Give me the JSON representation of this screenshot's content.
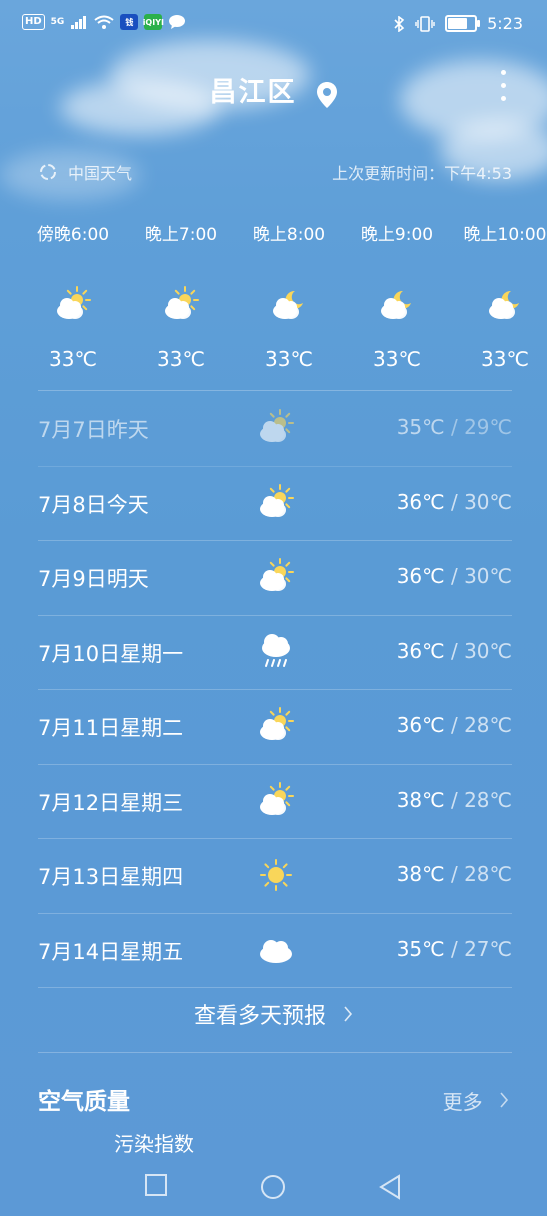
{
  "status": {
    "network": "HD",
    "signal_type": "5G",
    "app1": "钱",
    "app2": "iQIYI",
    "time": "5:23",
    "battery_percent": 88
  },
  "header": {
    "city": "昌江区",
    "icons": [
      "location-pin-icon",
      "more-vert-icon"
    ]
  },
  "source": {
    "provider": "中国天气",
    "updated": "上次更新时间：下午4:53"
  },
  "hourly": [
    {
      "time": "傍晚6:00",
      "icon": "sun-cloud",
      "temp": "33℃"
    },
    {
      "time": "晚上7:00",
      "icon": "sun-cloud",
      "temp": "33℃"
    },
    {
      "time": "晚上8:00",
      "icon": "moon-cloud",
      "temp": "33℃"
    },
    {
      "time": "晚上9:00",
      "icon": "moon-cloud",
      "temp": "33℃"
    },
    {
      "time": "晚上10:00",
      "icon": "moon-cloud",
      "temp": "33℃"
    }
  ],
  "daily": [
    {
      "label": "7月7日昨天",
      "icon": "sun-cloud",
      "high": "35℃",
      "sep": " / ",
      "low": "29℃",
      "past": true
    },
    {
      "label": "7月8日今天",
      "icon": "sun-cloud",
      "high": "36℃",
      "sep": " / ",
      "low": "30℃"
    },
    {
      "label": "7月9日明天",
      "icon": "sun-cloud",
      "high": "36℃",
      "sep": " / ",
      "low": "30℃"
    },
    {
      "label": "7月10日星期一",
      "icon": "rain-cloud",
      "high": "36℃",
      "sep": " / ",
      "low": "30℃"
    },
    {
      "label": "7月11日星期二",
      "icon": "sun-cloud",
      "high": "36℃",
      "sep": " / ",
      "low": "28℃"
    },
    {
      "label": "7月12日星期三",
      "icon": "sun-cloud",
      "high": "38℃",
      "sep": " / ",
      "low": "28℃"
    },
    {
      "label": "7月13日星期四",
      "icon": "sun",
      "high": "38℃",
      "sep": " / ",
      "low": "28℃"
    },
    {
      "label": "7月14日星期五",
      "icon": "cloud",
      "high": "35℃",
      "sep": " / ",
      "low": "27℃"
    }
  ],
  "forecast_link": "查看多天预报",
  "air_quality": {
    "title": "空气质量",
    "more": "更多",
    "subtitle": "污染指数"
  },
  "colors": {
    "sun": "#f9d65a",
    "cloud": "#ffffff"
  }
}
